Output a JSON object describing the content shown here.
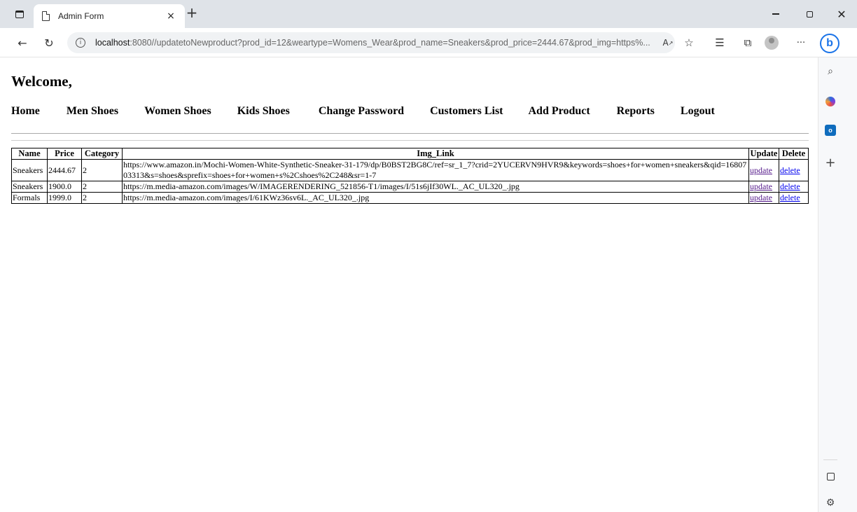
{
  "browser": {
    "tab_title": "Admin Form",
    "tab_close": "×",
    "new_tab": "+",
    "url_host": "localhost",
    "url_rest": ":8080//updatetoNewproduct?prod_id=12&weartype=Womens_Wear&prod_name=Sneakers&prod_price=2444.67&prod_img=https%...",
    "read_aloud": "Á'",
    "more": "···"
  },
  "page": {
    "welcome": "Welcome,",
    "menu": [
      "Home",
      "Men Shoes",
      "Women Shoes",
      "Kids Shoes",
      "Change Password",
      "Customers List",
      "Add Product",
      "Reports",
      "Logout"
    ]
  },
  "table": {
    "headers": [
      "Name",
      "Price",
      "Category",
      "Img_Link",
      "Update",
      "Delete"
    ],
    "rows": [
      {
        "name": "Sneakers",
        "price": "2444.67",
        "category": "2",
        "img_link": "https://www.amazon.in/Mochi-Women-White-Synthetic-Sneaker-31-179/dp/B0BST2BG8C/ref=sr_1_7?crid=2YUCERVN9HVR9&keywords=shoes+for+women+sneakers&qid=1680703313&s=shoes&sprefix=shoes+for+women+s%2Cshoes%2C248&sr=1-7",
        "update": "update",
        "delete": "delete"
      },
      {
        "name": "Sneakers",
        "price": "1900.0",
        "category": "2",
        "img_link": "https://m.media-amazon.com/images/W/IMAGERENDERING_521856-T1/images/I/51s6jIf30WL._AC_UL320_.jpg",
        "update": "update",
        "delete": "delete"
      },
      {
        "name": "Formals",
        "price": "1999.0",
        "category": "2",
        "img_link": "https://m.media-amazon.com/images/I/61KWz36sv6L._AC_UL320_.jpg",
        "update": "update",
        "delete": "delete"
      }
    ]
  },
  "icons": {
    "sidebar_toggle": "sidebar-icon",
    "back": "back-arrow-icon",
    "refresh": "refresh-icon",
    "info": "info-icon",
    "favorite": "star-add-icon",
    "favorites": "favorites-icon",
    "collections": "collections-icon",
    "search": "search-icon",
    "bing": "bing-icon",
    "settings": "gear-icon"
  }
}
